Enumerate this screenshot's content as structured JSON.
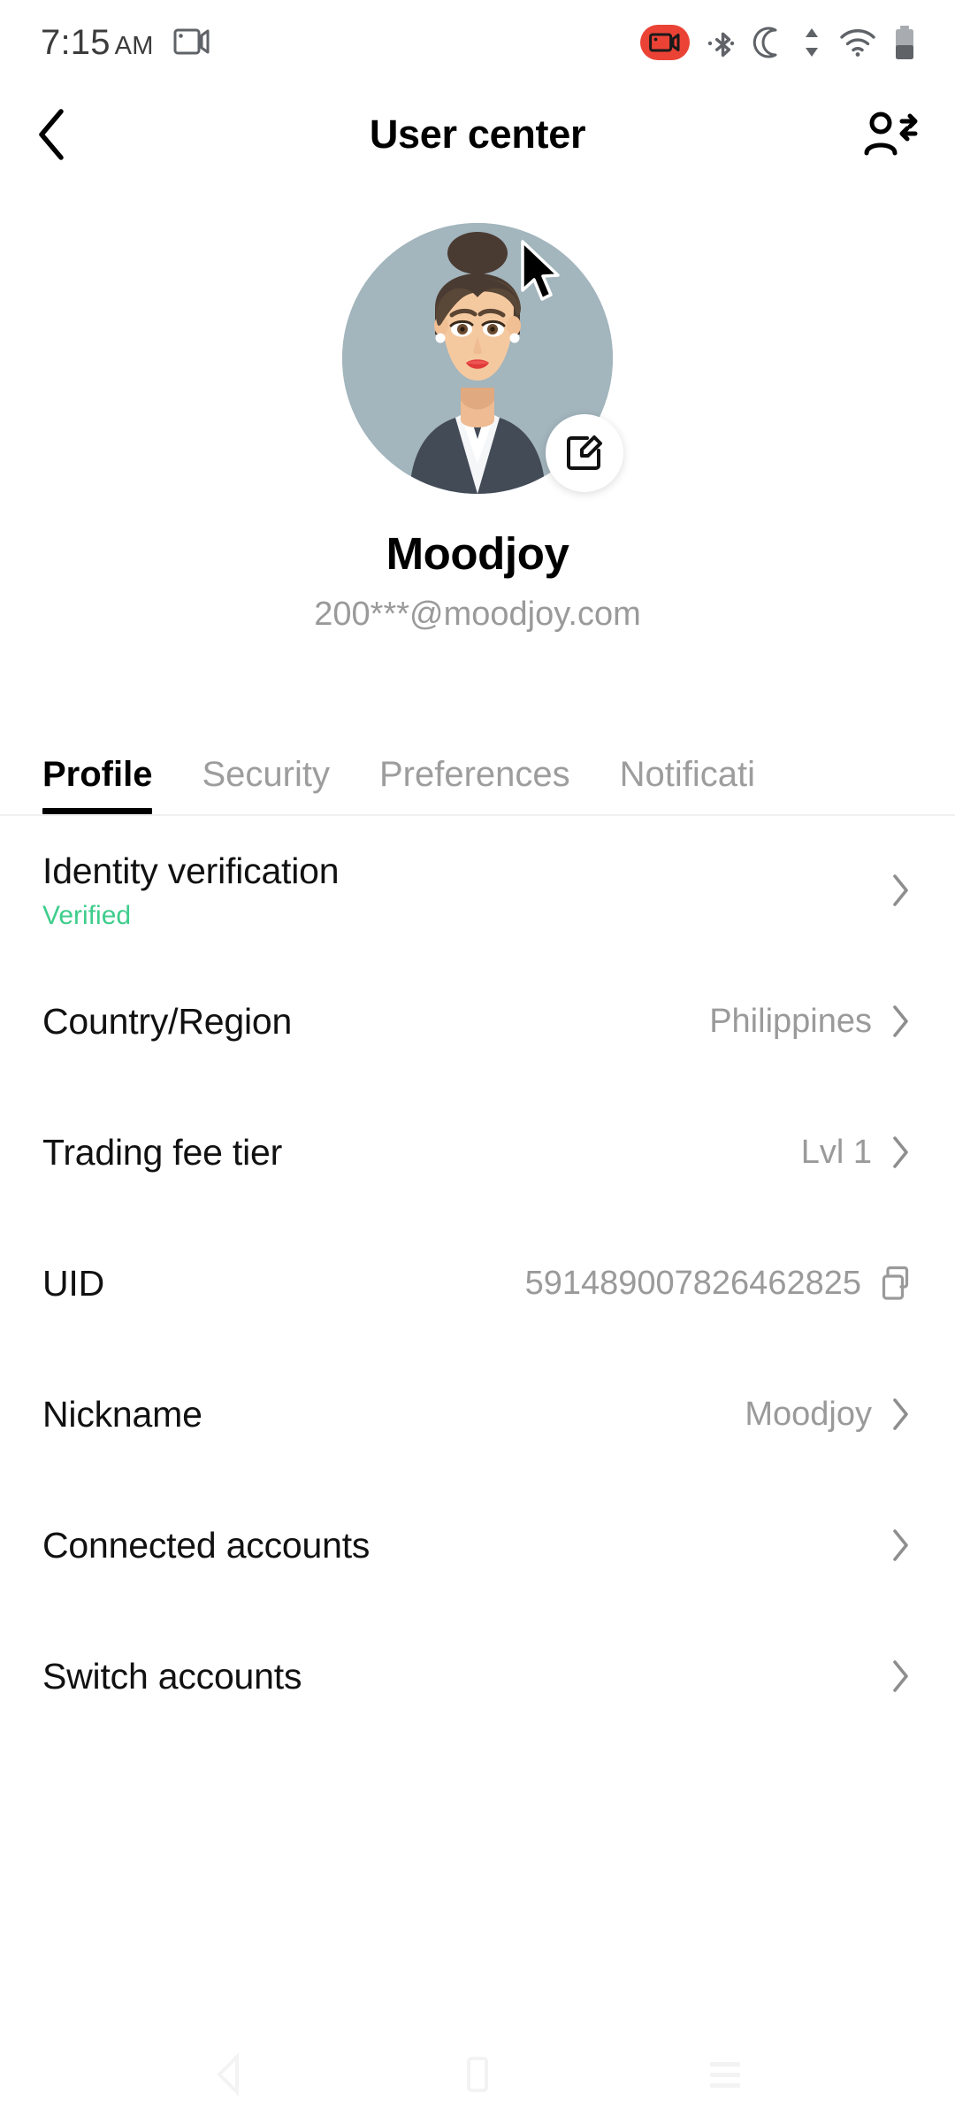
{
  "status_bar": {
    "time": "7:15",
    "ampm": "AM",
    "icons": {
      "screencast": "screencast-icon",
      "recording": "screen-recording-icon",
      "bluetooth": "bluetooth-icon",
      "dnd": "do-not-disturb-moon-icon",
      "data": "data-transfer-icon",
      "wifi": "wifi-icon",
      "battery": "battery-icon"
    }
  },
  "header": {
    "back_icon": "back-chevron-icon",
    "title": "User center",
    "action_icon": "switch-account-icon"
  },
  "profile": {
    "avatar_alt": "user-avatar",
    "avatar_bg": "#a3b5bd",
    "edit_icon": "edit-pencil-icon",
    "name": "Moodjoy",
    "email": "200***@moodjoy.com"
  },
  "tabs": {
    "items": [
      {
        "label": "Profile",
        "active": true
      },
      {
        "label": "Security",
        "active": false
      },
      {
        "label": "Preferences",
        "active": false
      },
      {
        "label": "Notificati",
        "active": false
      }
    ]
  },
  "list": {
    "rows": [
      {
        "label": "Identity verification",
        "sub": "Verified",
        "sub_color": "#3ecd8c",
        "value": "",
        "accessory": "chevron"
      },
      {
        "label": "Country/Region",
        "sub": "",
        "value": "Philippines",
        "accessory": "chevron"
      },
      {
        "label": "Trading fee tier",
        "sub": "",
        "value": "Lvl 1",
        "accessory": "chevron"
      },
      {
        "label": "UID",
        "sub": "",
        "value": "591489007826462825",
        "accessory": "copy"
      },
      {
        "label": "Nickname",
        "sub": "",
        "value": "Moodjoy",
        "accessory": "chevron"
      },
      {
        "label": "Connected accounts",
        "sub": "",
        "value": "",
        "accessory": "chevron"
      },
      {
        "label": "Switch accounts",
        "sub": "",
        "value": "",
        "accessory": "chevron"
      }
    ]
  },
  "nav_bar": {
    "back": "nav-back-icon",
    "home": "nav-home-icon",
    "recents": "nav-recents-icon"
  },
  "colors": {
    "accent_green": "#3ecd8c",
    "text_primary": "#111111",
    "text_muted": "#9a9a9a",
    "recording_red": "#ea4335"
  }
}
